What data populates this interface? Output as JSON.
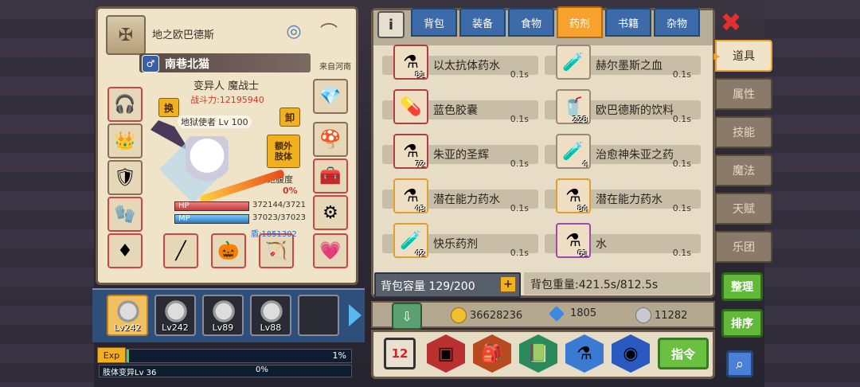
{
  "character": {
    "title": "地之欧巴德斯",
    "gender_icon": "♂",
    "name": "南巷北猫",
    "origin": "来自河南",
    "class": "变异人 魔战士",
    "power": "战斗力:12195940",
    "swap_label": "换",
    "unload_label": "卸",
    "extra_limb_label": "额外\n肢体",
    "satiety_label": "饱腹度",
    "satiety_value": "0%",
    "pet_level_text": "地狱使者 Lv 100",
    "hp_label": "HP",
    "hp_value": "372144/3721",
    "mp_label": "MP",
    "mp_value": "37023/37023",
    "shield_value": "盾:1851302"
  },
  "team": [
    {
      "level": "Lv242",
      "active": true
    },
    {
      "level": "Lv242",
      "active": false
    },
    {
      "level": "Lv89",
      "active": false
    },
    {
      "level": "Lv88",
      "active": false
    },
    {
      "level": "",
      "active": false
    }
  ],
  "exp": {
    "tag": "Exp",
    "percent": "1%",
    "fill_fraction": 0.01,
    "mutation_label": "肢体变异Lv 36",
    "mutation_percent": "0%"
  },
  "tabs": [
    "背包",
    "装备",
    "食物",
    "药剂",
    "书籍",
    "杂物"
  ],
  "active_tab": "药剂",
  "items": [
    {
      "name": "以太抗体药水",
      "count": "81",
      "time": "0.1s",
      "icon": "⚗",
      "border": "red"
    },
    {
      "name": "赫尔墨斯之血",
      "count": "",
      "time": "0.1s",
      "icon": "🧪",
      "border": "gray"
    },
    {
      "name": "蓝色胶囊",
      "count": "",
      "time": "0.1s",
      "icon": "💊",
      "border": "red"
    },
    {
      "name": "欧巴德斯的饮料",
      "count": "228",
      "time": "0.1s",
      "icon": "🥤",
      "border": "gray"
    },
    {
      "name": "朱亚的圣辉",
      "count": "72",
      "time": "0.1s",
      "icon": "⚗",
      "border": "red"
    },
    {
      "name": "治愈神朱亚之药",
      "count": "4",
      "time": "0.1s",
      "icon": "🧪",
      "border": "gray"
    },
    {
      "name": "潜在能力药水",
      "count": "43",
      "time": "0.1s",
      "icon": "⚗",
      "border": "orange"
    },
    {
      "name": "潜在能力药水",
      "count": "84",
      "time": "0.1s",
      "icon": "⚗",
      "border": "orange"
    },
    {
      "name": "快乐药剂",
      "count": "42",
      "time": "0.1s",
      "icon": "🧪",
      "border": "orange"
    },
    {
      "name": "水",
      "count": "61",
      "time": "0.1s",
      "icon": "⚗",
      "border": "purple"
    }
  ],
  "capacity": "背包容量 129/200",
  "capacity_plus": "+",
  "weight": "背包重量:421.5s/812.5s",
  "currency": {
    "gold": "36628236",
    "diamond": "1805",
    "silver": "11282"
  },
  "command_label": "指令",
  "sort_icon_label": "12",
  "side_tabs": [
    "道具",
    "属性",
    "技能",
    "魔法",
    "天赋",
    "乐团"
  ],
  "active_side_tab": "道具",
  "organize_label": "整理",
  "sort_label": "排序",
  "info_label": "i",
  "close_label": "✖",
  "colors": {
    "active_tab": "#f6a22c",
    "tab": "#3d6aa8",
    "green_button": "#62b838",
    "power_red": "#d03a2a"
  }
}
